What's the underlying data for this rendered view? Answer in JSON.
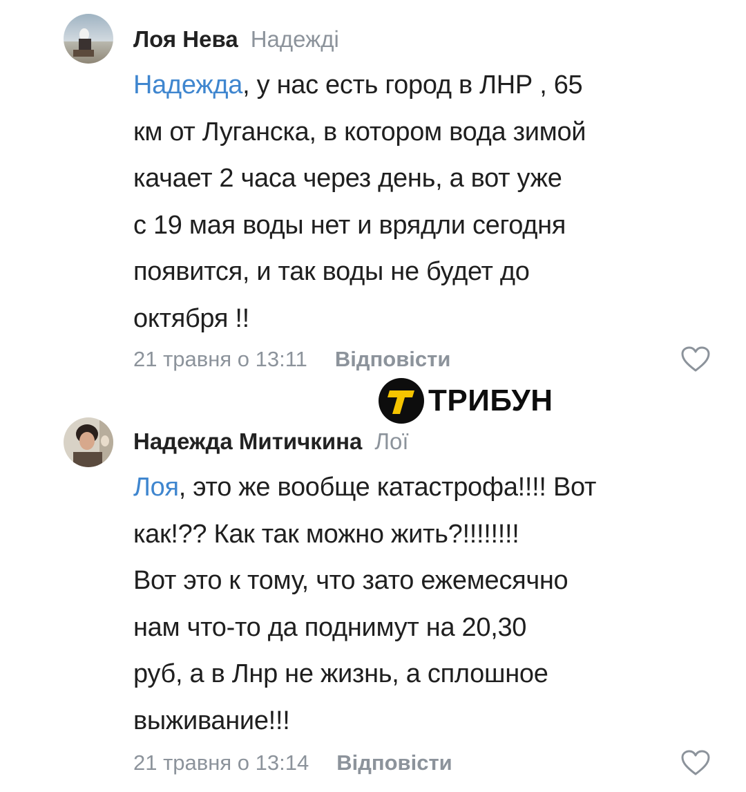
{
  "watermark": {
    "brand": "ТРИБУН"
  },
  "comments": [
    {
      "author": "Лоя Нева",
      "reply_to": "Надежді",
      "mention": "Надежда",
      "text_lines": [
        ", у нас есть город в ЛНР , 65",
        "км от Луганска, в котором вода зимой",
        "качает 2 часа через день, а вот уже",
        "с 19 мая воды нет и врядли сегодня",
        "появится, и так воды не будет до",
        "октября !!"
      ],
      "timestamp": "21 травня о 13:11",
      "reply_label": "Відповісти"
    },
    {
      "author": "Надежда Митичкина",
      "reply_to": "Лої",
      "mention": "Лоя",
      "text_lines": [
        ", это же вообще катастрофа!!!! Вот",
        "как!?? Как так можно жить?!!!!!!!!",
        "Вот это к тому, что зато ежемесячно",
        "нам что-то да поднимут на 20,30",
        "руб, а в Лнр не жизнь, а сплошное",
        "выживание!!!"
      ],
      "timestamp": "21 травня о 13:14",
      "reply_label": "Відповісти"
    }
  ]
}
